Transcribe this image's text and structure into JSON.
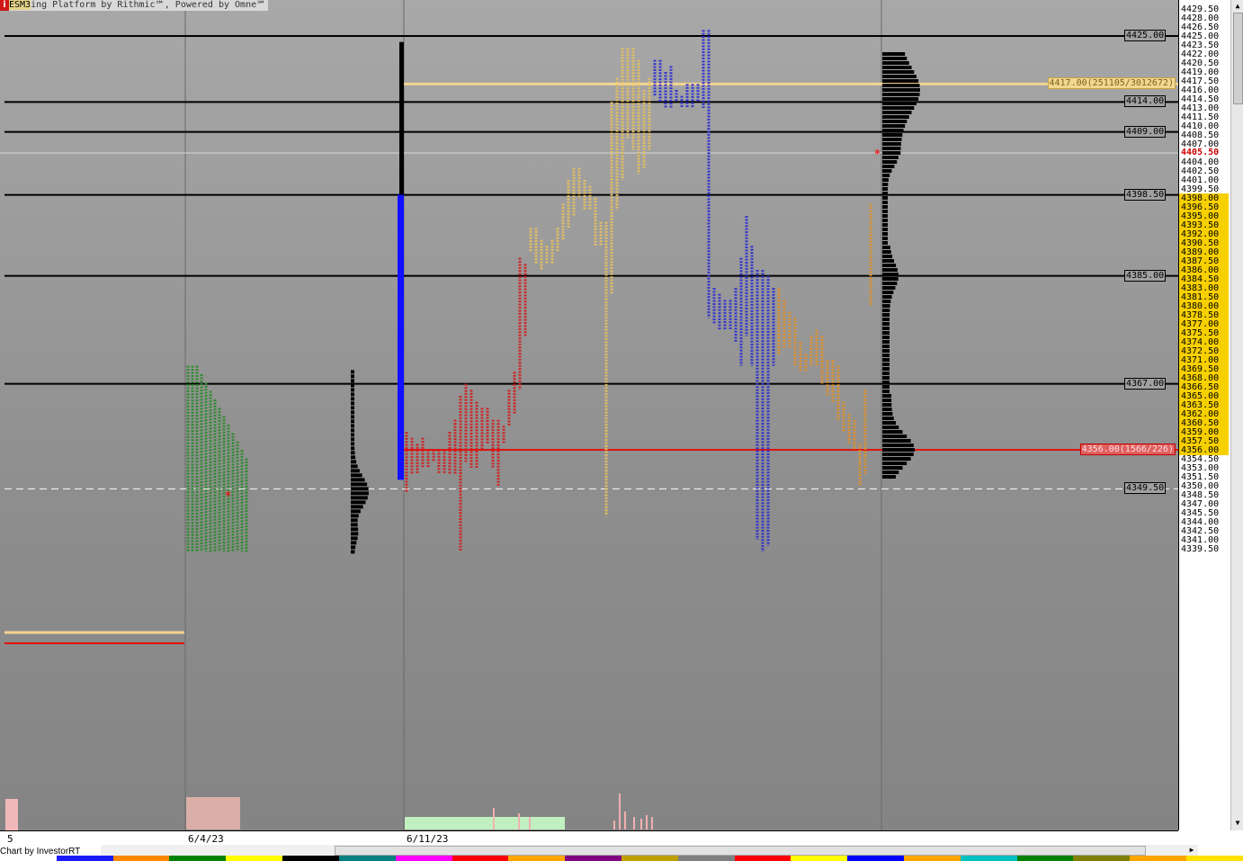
{
  "window": {
    "app_icon": "i",
    "symbol": "ESM3",
    "title_rest": "ing Platform by Rithmic℠, Powered by Omne℠",
    "maximize_icon": "M"
  },
  "price_axis": {
    "ticks": [
      "4429.50",
      "4428.00",
      "4426.50",
      "4425.00",
      "4423.50",
      "4422.00",
      "4420.50",
      "4419.00",
      "4417.50",
      "4416.00",
      "4414.50",
      "4413.00",
      "4411.50",
      "4410.00",
      "4408.50",
      "4407.00",
      "4405.50",
      "4404.00",
      "4402.50",
      "4401.00",
      "4399.50",
      "4398.00",
      "4396.50",
      "4395.00",
      "4393.50",
      "4392.00",
      "4390.50",
      "4389.00",
      "4387.50",
      "4386.00",
      "4384.50",
      "4383.00",
      "4381.50",
      "4380.00",
      "4378.50",
      "4377.00",
      "4375.50",
      "4374.00",
      "4372.50",
      "4371.00",
      "4369.50",
      "4368.00",
      "4366.50",
      "4365.00",
      "4363.50",
      "4362.00",
      "4360.50",
      "4359.00",
      "4357.50",
      "4356.00",
      "4354.50",
      "4353.00",
      "4351.50",
      "4350.00",
      "4348.50",
      "4347.00",
      "4345.50",
      "4344.00",
      "4342.50",
      "4341.00",
      "4339.50"
    ],
    "highlight_range": [
      "4398.00",
      "4356.00"
    ],
    "last_price": "4405.50",
    "highlight_color": "#f7d000"
  },
  "levels": [
    {
      "price": 4425.0,
      "label": "4425.00",
      "style": "black"
    },
    {
      "price": 4414.0,
      "label": "4414.00",
      "style": "black"
    },
    {
      "price": 4409.0,
      "label": "4409.00",
      "style": "black"
    },
    {
      "price": 4398.5,
      "label": "4398.50",
      "style": "black"
    },
    {
      "price": 4385.0,
      "label": "4385.00",
      "style": "black"
    },
    {
      "price": 4367.0,
      "label": "4367.00",
      "style": "black"
    },
    {
      "price": 4349.5,
      "label": "4349.50",
      "style": "dashed"
    }
  ],
  "poc_label": "4417.00(251105/3012672)",
  "red_label": "4356.00(1566/226)",
  "dates": [
    "6/4/23",
    "6/11/23"
  ],
  "left_label": "5",
  "credit": "Chart by InvestorRT",
  "colors": {
    "yellow_profile": "#e8c060",
    "blue_profile": "#3030d0",
    "red_profile": "#d02020",
    "orange_profile": "#e0902a",
    "green_profile": "#2a8a2a",
    "poc_line": "#f3d390",
    "red_line": "#e01010",
    "bar_blue": "#1010ff"
  },
  "bottom_colors": [
    "#ffffff",
    "#1a1aff",
    "#ff8800",
    "#008000",
    "#ffff00",
    "#000000",
    "#008080",
    "#ff00ff",
    "#ff0000",
    "#ffa500",
    "#800080",
    "#c0a000",
    "#808080",
    "#ff0000",
    "#ffff00",
    "#0000ff",
    "#ffa500",
    "#00c0c0",
    "#008000",
    "#808000",
    "#ffa500",
    "#ffe000"
  ]
}
